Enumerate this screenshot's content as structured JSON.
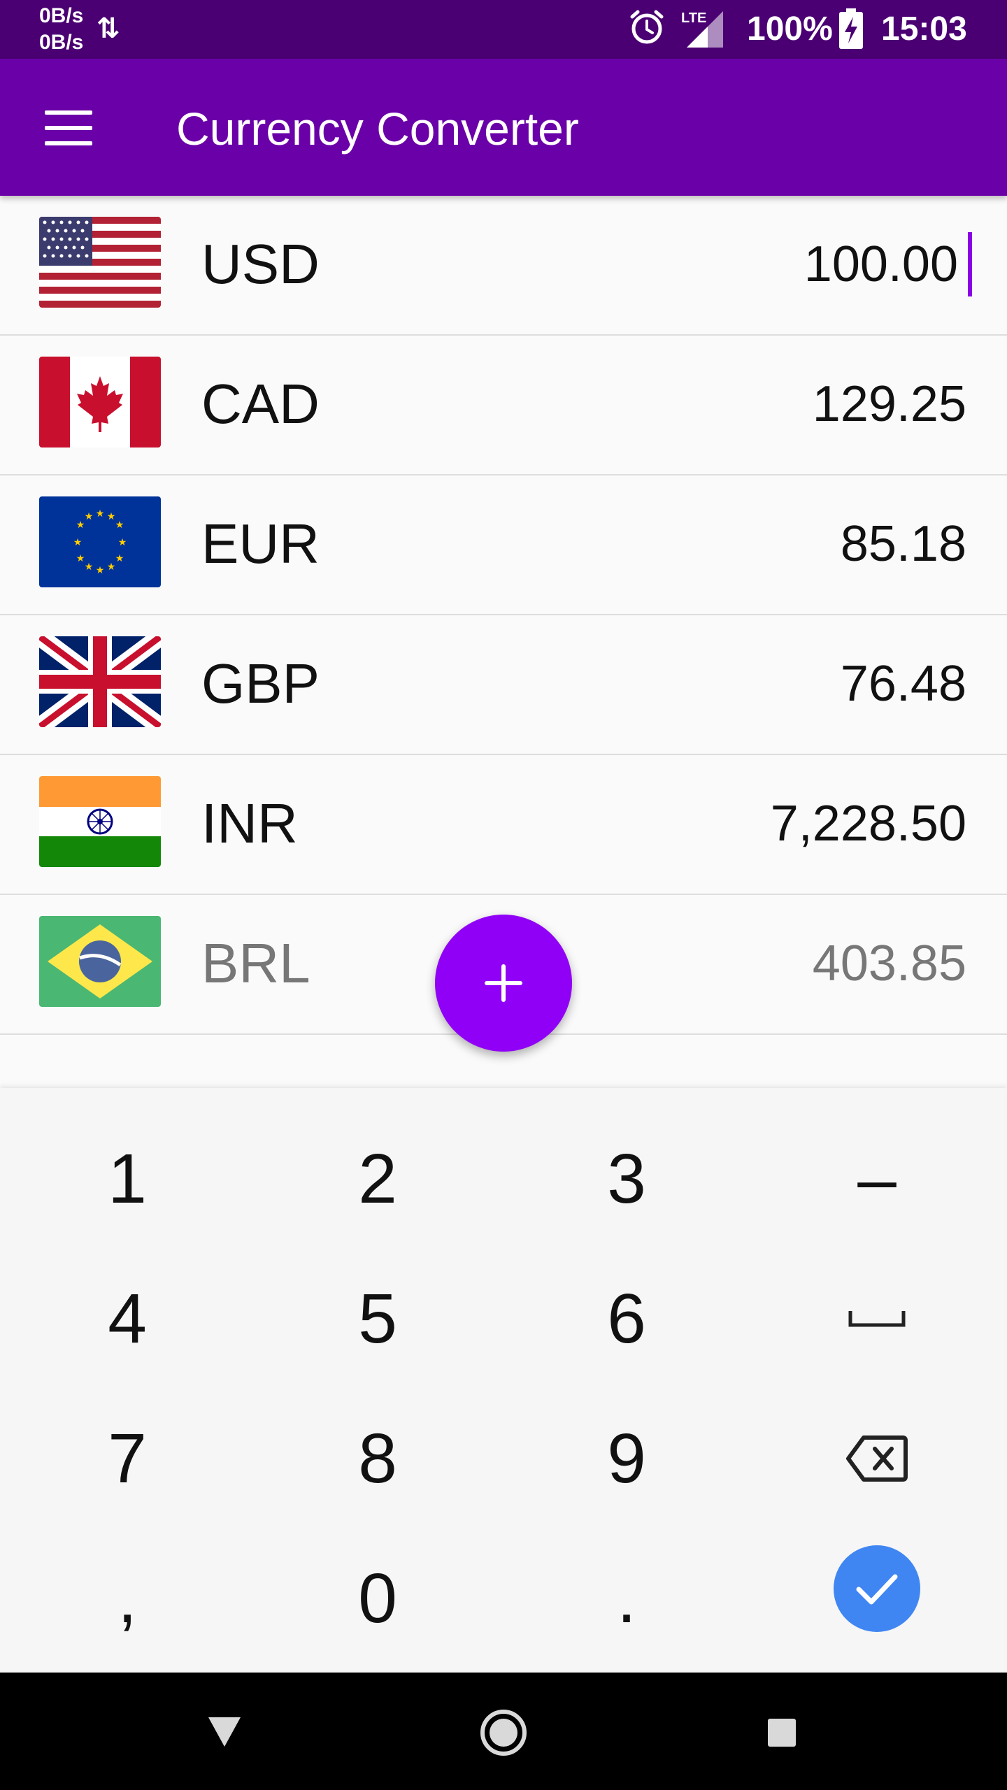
{
  "status_bar": {
    "net_up": "0B/s",
    "net_down": "0B/s",
    "network": "LTE",
    "battery": "100%",
    "time": "15:03"
  },
  "app_bar": {
    "title": "Currency Converter"
  },
  "currencies": [
    {
      "code": "USD",
      "amount": "100.00",
      "flag": "us-flag"
    },
    {
      "code": "CAD",
      "amount": "129.25",
      "flag": "canada-flag"
    },
    {
      "code": "EUR",
      "amount": "85.18",
      "flag": "eu-flag"
    },
    {
      "code": "GBP",
      "amount": "76.48",
      "flag": "uk-flag"
    },
    {
      "code": "INR",
      "amount": "7,228.50",
      "flag": "india-flag"
    },
    {
      "code": "BRL",
      "amount": "403.85",
      "flag": "brazil-flag"
    }
  ],
  "keypad": {
    "rows": [
      [
        "1",
        "2",
        "3",
        "–"
      ],
      [
        "4",
        "5",
        "6",
        "␣"
      ],
      [
        "7",
        "8",
        "9",
        "backspace"
      ],
      [
        ",",
        "0",
        ".",
        "done"
      ]
    ]
  },
  "colors": {
    "status_bar": "#4A0072",
    "app_bar": "#6A00A8",
    "fab": "#9100F6",
    "done_button": "#3F86F2"
  }
}
